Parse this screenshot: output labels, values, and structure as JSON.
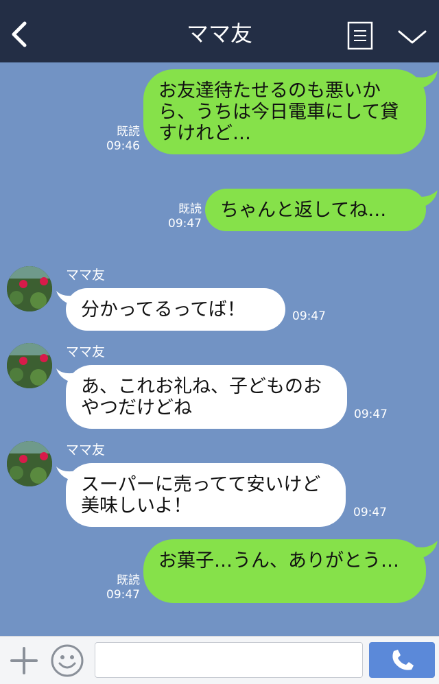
{
  "header": {
    "title": "ママ友"
  },
  "contact": {
    "name": "ママ友"
  },
  "messages": [
    {
      "direction": "out",
      "text": "お友達待たせるのも悪いから、うちは今日電車にして貸すけれど…",
      "read": "既読",
      "time": "09:46"
    },
    {
      "direction": "out",
      "text": "ちゃんと返してね…",
      "read": "既読",
      "time": "09:47"
    },
    {
      "direction": "in",
      "sender": "ママ友",
      "text": "分かってるってば！",
      "time": "09:47"
    },
    {
      "direction": "in",
      "sender": "ママ友",
      "text": "あ、これお礼ね、子どものおやつだけどね",
      "time": "09:47"
    },
    {
      "direction": "in",
      "sender": "ママ友",
      "text": "スーパーに売ってて安いけど美味しいよ！",
      "time": "09:47"
    },
    {
      "direction": "out",
      "text": "お菓子…うん、ありがとう…",
      "read": "既読",
      "time": "09:47"
    }
  ],
  "input": {
    "value": "",
    "placeholder": ""
  },
  "icons": {
    "back": "chevron-left-icon",
    "menu": "list-icon",
    "more": "chevron-down-icon",
    "add": "plus-icon",
    "emoji": "smiley-icon",
    "send": "phone-icon"
  },
  "colors": {
    "header": "#232e45",
    "background": "#7293c4",
    "outgoing_bubble": "#86e14a",
    "incoming_bubble": "#ffffff",
    "send_button": "#5b89d9"
  }
}
